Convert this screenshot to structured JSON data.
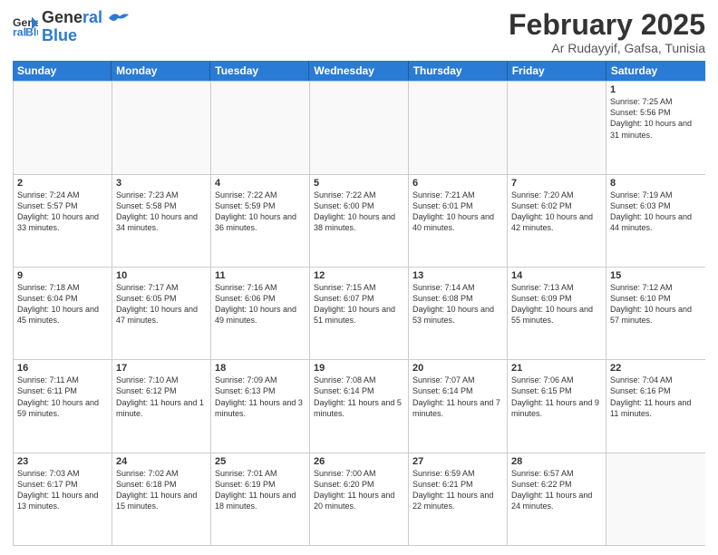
{
  "header": {
    "logo_line1": "General",
    "logo_line2": "Blue",
    "month_title": "February 2025",
    "location": "Ar Rudayyif, Gafsa, Tunisia"
  },
  "weekdays": [
    "Sunday",
    "Monday",
    "Tuesday",
    "Wednesday",
    "Thursday",
    "Friday",
    "Saturday"
  ],
  "weeks": [
    [
      {
        "day": "",
        "info": ""
      },
      {
        "day": "",
        "info": ""
      },
      {
        "day": "",
        "info": ""
      },
      {
        "day": "",
        "info": ""
      },
      {
        "day": "",
        "info": ""
      },
      {
        "day": "",
        "info": ""
      },
      {
        "day": "1",
        "info": "Sunrise: 7:25 AM\nSunset: 5:56 PM\nDaylight: 10 hours and 31 minutes."
      }
    ],
    [
      {
        "day": "2",
        "info": "Sunrise: 7:24 AM\nSunset: 5:57 PM\nDaylight: 10 hours and 33 minutes."
      },
      {
        "day": "3",
        "info": "Sunrise: 7:23 AM\nSunset: 5:58 PM\nDaylight: 10 hours and 34 minutes."
      },
      {
        "day": "4",
        "info": "Sunrise: 7:22 AM\nSunset: 5:59 PM\nDaylight: 10 hours and 36 minutes."
      },
      {
        "day": "5",
        "info": "Sunrise: 7:22 AM\nSunset: 6:00 PM\nDaylight: 10 hours and 38 minutes."
      },
      {
        "day": "6",
        "info": "Sunrise: 7:21 AM\nSunset: 6:01 PM\nDaylight: 10 hours and 40 minutes."
      },
      {
        "day": "7",
        "info": "Sunrise: 7:20 AM\nSunset: 6:02 PM\nDaylight: 10 hours and 42 minutes."
      },
      {
        "day": "8",
        "info": "Sunrise: 7:19 AM\nSunset: 6:03 PM\nDaylight: 10 hours and 44 minutes."
      }
    ],
    [
      {
        "day": "9",
        "info": "Sunrise: 7:18 AM\nSunset: 6:04 PM\nDaylight: 10 hours and 45 minutes."
      },
      {
        "day": "10",
        "info": "Sunrise: 7:17 AM\nSunset: 6:05 PM\nDaylight: 10 hours and 47 minutes."
      },
      {
        "day": "11",
        "info": "Sunrise: 7:16 AM\nSunset: 6:06 PM\nDaylight: 10 hours and 49 minutes."
      },
      {
        "day": "12",
        "info": "Sunrise: 7:15 AM\nSunset: 6:07 PM\nDaylight: 10 hours and 51 minutes."
      },
      {
        "day": "13",
        "info": "Sunrise: 7:14 AM\nSunset: 6:08 PM\nDaylight: 10 hours and 53 minutes."
      },
      {
        "day": "14",
        "info": "Sunrise: 7:13 AM\nSunset: 6:09 PM\nDaylight: 10 hours and 55 minutes."
      },
      {
        "day": "15",
        "info": "Sunrise: 7:12 AM\nSunset: 6:10 PM\nDaylight: 10 hours and 57 minutes."
      }
    ],
    [
      {
        "day": "16",
        "info": "Sunrise: 7:11 AM\nSunset: 6:11 PM\nDaylight: 10 hours and 59 minutes."
      },
      {
        "day": "17",
        "info": "Sunrise: 7:10 AM\nSunset: 6:12 PM\nDaylight: 11 hours and 1 minute."
      },
      {
        "day": "18",
        "info": "Sunrise: 7:09 AM\nSunset: 6:13 PM\nDaylight: 11 hours and 3 minutes."
      },
      {
        "day": "19",
        "info": "Sunrise: 7:08 AM\nSunset: 6:14 PM\nDaylight: 11 hours and 5 minutes."
      },
      {
        "day": "20",
        "info": "Sunrise: 7:07 AM\nSunset: 6:14 PM\nDaylight: 11 hours and 7 minutes."
      },
      {
        "day": "21",
        "info": "Sunrise: 7:06 AM\nSunset: 6:15 PM\nDaylight: 11 hours and 9 minutes."
      },
      {
        "day": "22",
        "info": "Sunrise: 7:04 AM\nSunset: 6:16 PM\nDaylight: 11 hours and 11 minutes."
      }
    ],
    [
      {
        "day": "23",
        "info": "Sunrise: 7:03 AM\nSunset: 6:17 PM\nDaylight: 11 hours and 13 minutes."
      },
      {
        "day": "24",
        "info": "Sunrise: 7:02 AM\nSunset: 6:18 PM\nDaylight: 11 hours and 15 minutes."
      },
      {
        "day": "25",
        "info": "Sunrise: 7:01 AM\nSunset: 6:19 PM\nDaylight: 11 hours and 18 minutes."
      },
      {
        "day": "26",
        "info": "Sunrise: 7:00 AM\nSunset: 6:20 PM\nDaylight: 11 hours and 20 minutes."
      },
      {
        "day": "27",
        "info": "Sunrise: 6:59 AM\nSunset: 6:21 PM\nDaylight: 11 hours and 22 minutes."
      },
      {
        "day": "28",
        "info": "Sunrise: 6:57 AM\nSunset: 6:22 PM\nDaylight: 11 hours and 24 minutes."
      },
      {
        "day": "",
        "info": ""
      }
    ]
  ]
}
